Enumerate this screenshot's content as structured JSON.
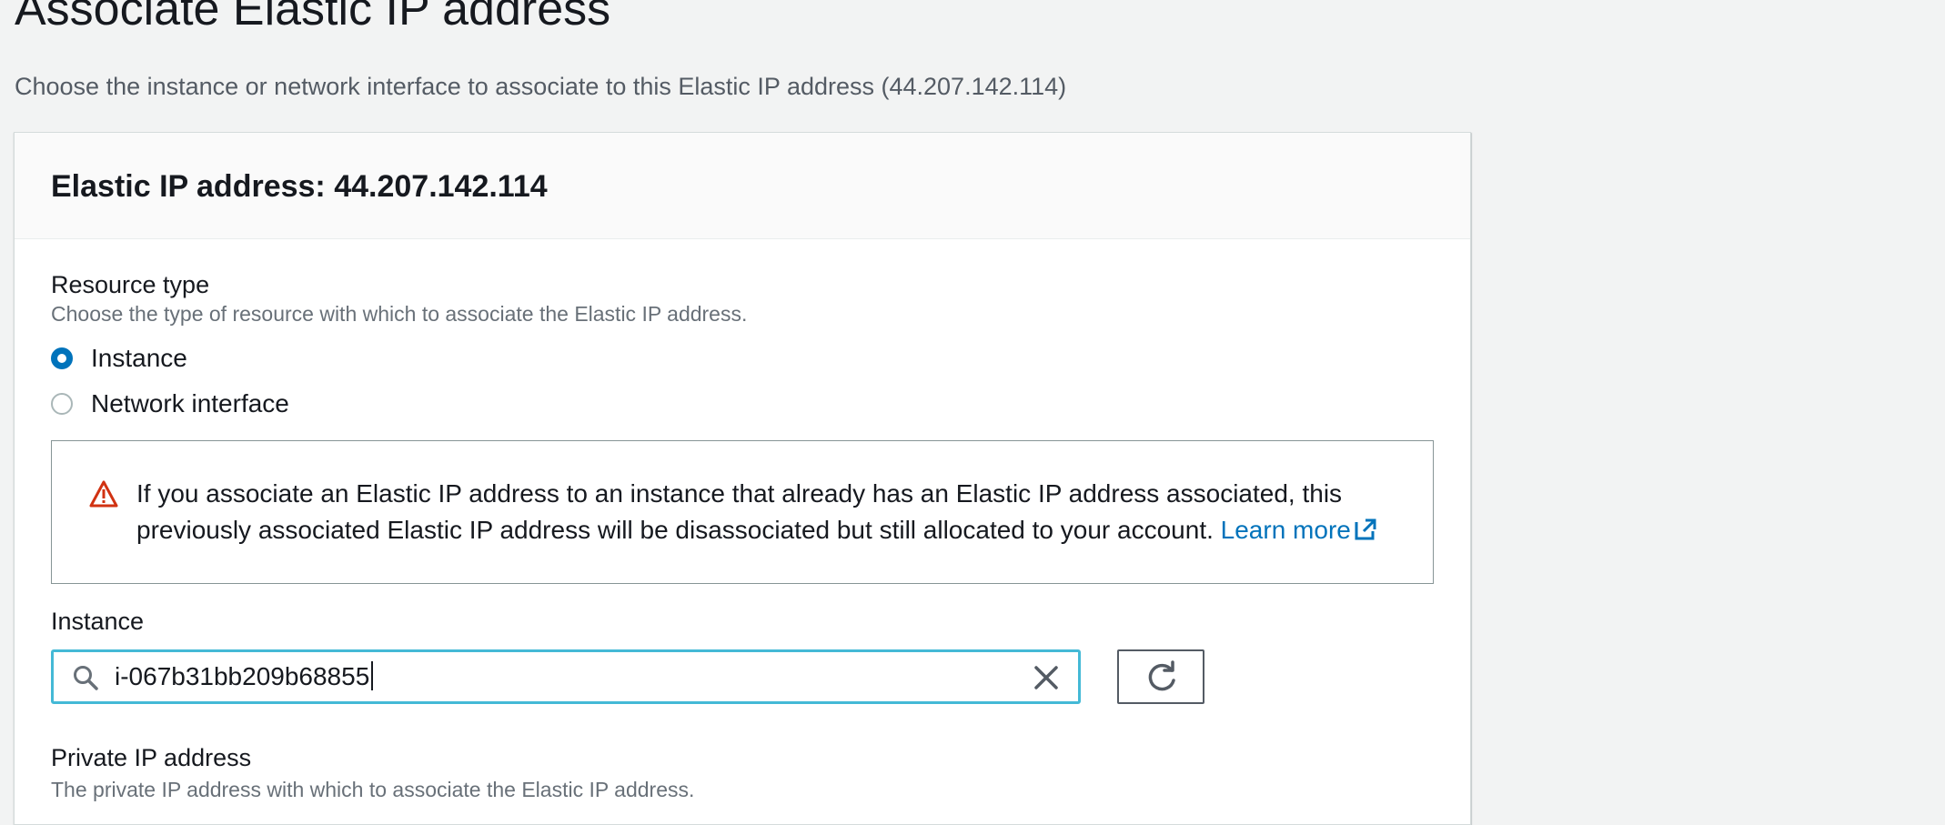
{
  "page": {
    "title": "Associate Elastic IP address",
    "subtitle": "Choose the instance or network interface to associate to this Elastic IP address (44.207.142.114)"
  },
  "panel": {
    "header": "Elastic IP address: 44.207.142.114"
  },
  "resource_type": {
    "label": "Resource type",
    "description": "Choose the type of resource with which to associate the Elastic IP address.",
    "options": [
      {
        "label": "Instance",
        "checked": true
      },
      {
        "label": "Network interface",
        "checked": false
      }
    ]
  },
  "alert": {
    "icon": "warning-icon",
    "text": "If you associate an Elastic IP address to an instance that already has an Elastic IP address associated, this previously associated Elastic IP address will be disassociated but still allocated to your account.",
    "link_label": "Learn more",
    "link_icon": "external-link-icon"
  },
  "instance": {
    "label": "Instance",
    "value": "i-067b31bb209b68855",
    "search_icon": "search-icon",
    "clear_icon": "close-icon",
    "refresh_icon": "refresh-icon"
  },
  "private_ip": {
    "label": "Private IP address",
    "description": "The private IP address with which to associate the Elastic IP address."
  },
  "colors": {
    "link": "#0073bb",
    "radio_checked": "#0073bb",
    "focus_border": "#44b9d6",
    "warning": "#d13212",
    "background": "#f2f3f3"
  }
}
